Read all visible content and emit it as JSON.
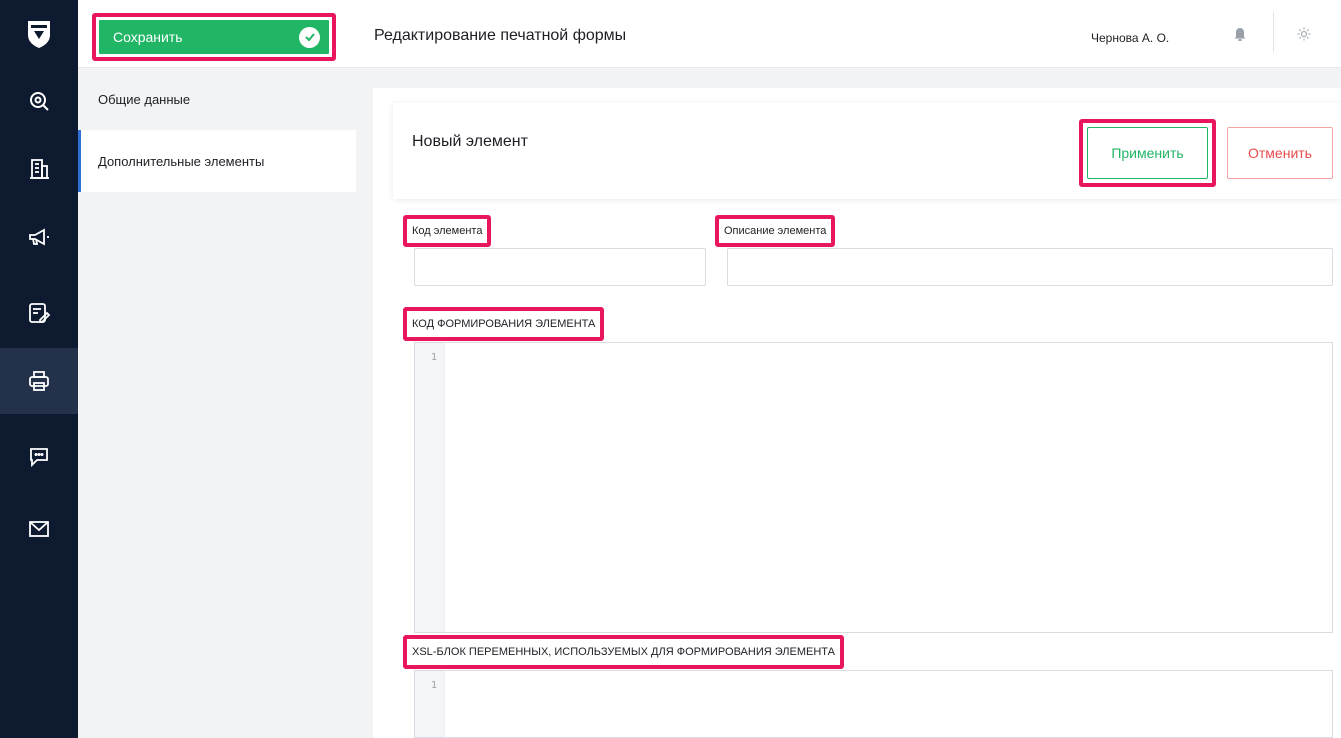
{
  "rail": {
    "items": [
      {
        "icon": "search-icon"
      },
      {
        "icon": "building-icon"
      },
      {
        "icon": "megaphone-icon"
      },
      {
        "icon": "edit-document-icon"
      },
      {
        "icon": "printer-icon",
        "active": true
      },
      {
        "icon": "chat-icon"
      },
      {
        "icon": "mail-icon"
      }
    ]
  },
  "toolbar": {
    "save_label": "Сохранить",
    "page_title": "Редактирование печатной формы",
    "user_name": "Чернова А. О."
  },
  "sidebar": {
    "items": [
      {
        "label": "Общие данные"
      },
      {
        "label": "Дополнительные элементы",
        "active": true
      }
    ]
  },
  "card": {
    "title": "Новый элемент",
    "apply_label": "Применить",
    "cancel_label": "Отменить"
  },
  "form": {
    "code_label": "Код элемента",
    "code_value": "",
    "description_label": "Описание элемента",
    "description_value": "",
    "generation_code_label": "КОД ФОРМИРОВАНИЯ ЭЛЕМЕНТА",
    "generation_code_line": "1",
    "xsl_block_label": "XSL-БЛОК ПЕРЕМЕННЫХ, ИСПОЛЬЗУЕМЫХ ДЛЯ ФОРМИРОВАНИЯ ЭЛЕМЕНТА",
    "xsl_block_line": "1"
  },
  "colors": {
    "rail": "#0d1a2f",
    "accent_green": "#21b566",
    "highlight": "#e8175d",
    "cancel_red": "#e64b4b"
  }
}
